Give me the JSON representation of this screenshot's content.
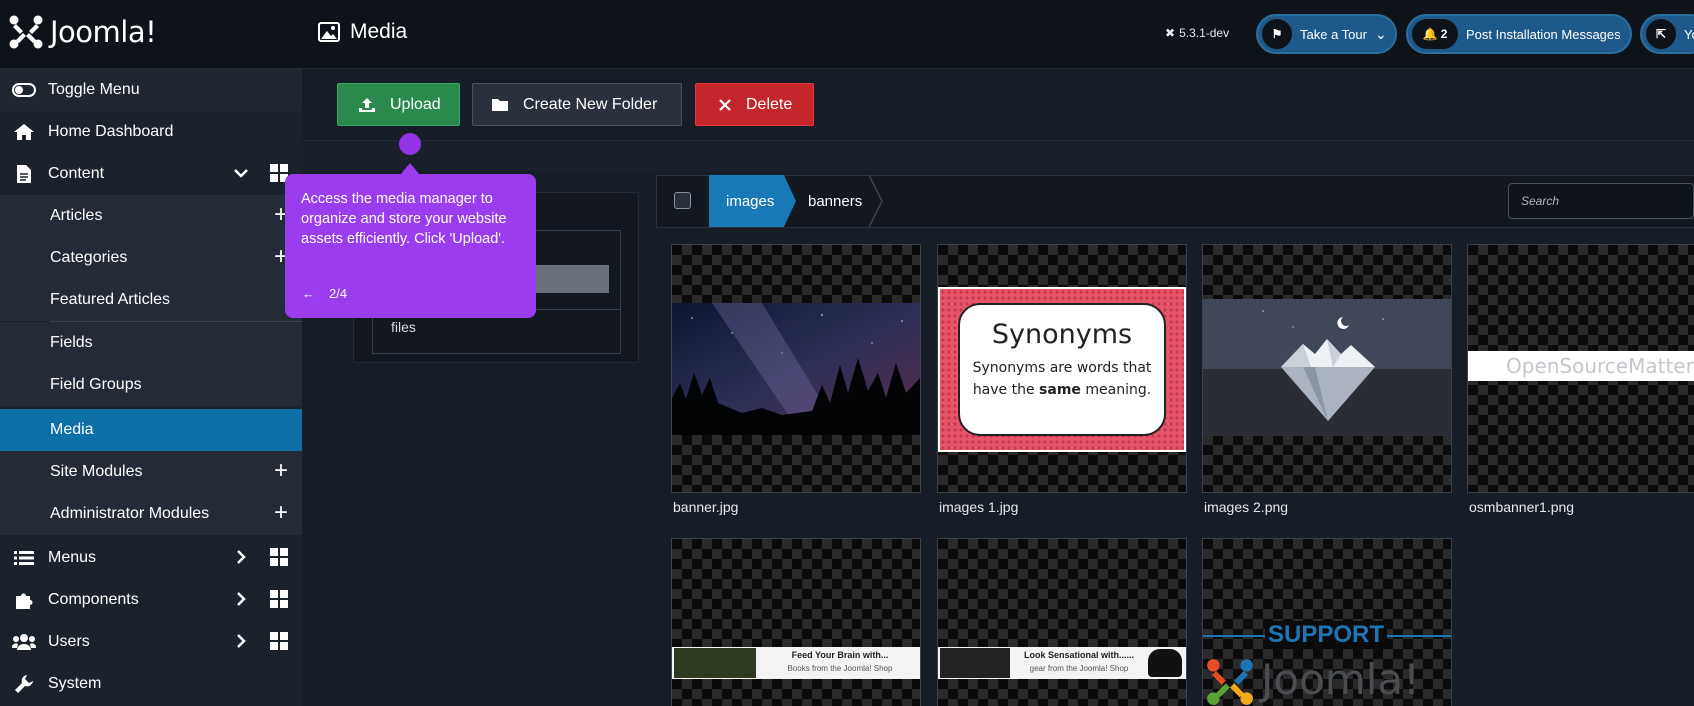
{
  "header": {
    "brand": "Joomla!",
    "page_title": "Media",
    "version": "5.3.1-dev",
    "tour_label": "Take a Tour",
    "post_count": "2",
    "post_label": "Post Installation Messages",
    "user_label": "Yo"
  },
  "sidebar": {
    "toggle": "Toggle Menu",
    "home": "Home Dashboard",
    "content": "Content",
    "sub": [
      "Articles",
      "Categories",
      "Featured Articles",
      "Fields",
      "Field Groups",
      "Media",
      "Site Modules",
      "Administrator Modules"
    ],
    "menus": "Menus",
    "components": "Components",
    "users": "Users",
    "system": "System"
  },
  "toolbar": {
    "upload": "Upload",
    "new_folder": "Create New Folder",
    "delete": "Delete"
  },
  "tree": {
    "files": "files"
  },
  "breadcrumb": {
    "images": "images",
    "banners": "banners"
  },
  "search": {
    "placeholder": "Search"
  },
  "files": [
    "banner.jpg",
    "images 1.jpg",
    "images 2.png",
    "osmbanner1.png"
  ],
  "thumb_text": {
    "synonyms_title": "Synonyms",
    "synonyms_line1": "Synonyms are words that",
    "synonyms_line2_a": "have the ",
    "synonyms_line2_b": "same",
    "synonyms_line2_c": " meaning.",
    "osm": "OpenSourceMatters",
    "ad1_title": "Feed Your Brain with...",
    "ad1_sub": "Books from the Joomla! Shop",
    "ad2_title": "Look Sensational with......",
    "ad2_sub": "gear from the Joomla! Shop",
    "support": "SUPPORT",
    "support_brand": "Joomla!"
  },
  "tooltip": {
    "text": "Access the media manager to organize and store your website assets efficiently. Click 'Upload'.",
    "step": "2/4",
    "back": "←"
  },
  "colors": {
    "accent": "#0c6fa5",
    "tooltip": "#9b3dee",
    "upload": "#2a8a4e",
    "delete": "#c5262b"
  }
}
